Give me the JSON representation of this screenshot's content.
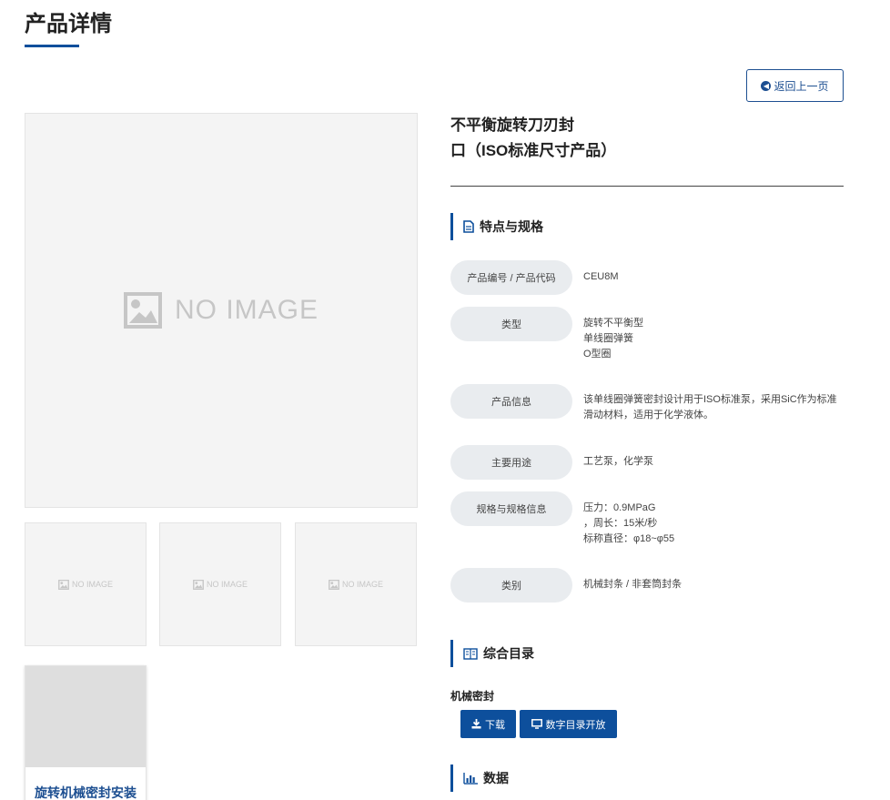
{
  "page": {
    "title": "产品详情"
  },
  "back_button": {
    "label": "返回上一页"
  },
  "images": {
    "no_image_text": "NO IMAGE"
  },
  "video": {
    "title": "旋转机械密封安装"
  },
  "product": {
    "name_line1": "不平衡旋转刀刃封",
    "name_line2": "口（ISO标准尺寸产品）"
  },
  "specs_section": {
    "title": "特点与规格"
  },
  "specs": [
    {
      "label": "产品编号 / 产品代码",
      "lines": [
        "CEU8M"
      ]
    },
    {
      "label": "类型",
      "lines": [
        "旋转不平衡型",
        "单线圈弹簧",
        "O型圈"
      ]
    },
    {
      "label": "产品信息",
      "lines": [
        "该单线圈弹簧密封设计用于ISO标准泵，采用SiC作为标准",
        "滑动材料，适用于化学液体。"
      ]
    },
    {
      "label": "主要用途",
      "lines": [
        "工艺泵，化学泵"
      ]
    },
    {
      "label": "规格与规格信息",
      "lines": [
        "压力：0.9MPaG",
        "，周长：15米/秒",
        "标称直径：φ18~φ55"
      ]
    },
    {
      "label": "类别",
      "lines": [
        "机械封条 / 非套筒封条"
      ]
    }
  ],
  "catalog_section": {
    "title": "综合目录",
    "item_label": "机械密封",
    "download_label": "下载",
    "digital_label": "数字目录开放"
  },
  "data_section": {
    "title": "数据"
  },
  "colors": {
    "accent": "#0d4f9c",
    "label_bg": "#e9ecef",
    "placeholder_bg": "#f4f4f4"
  }
}
